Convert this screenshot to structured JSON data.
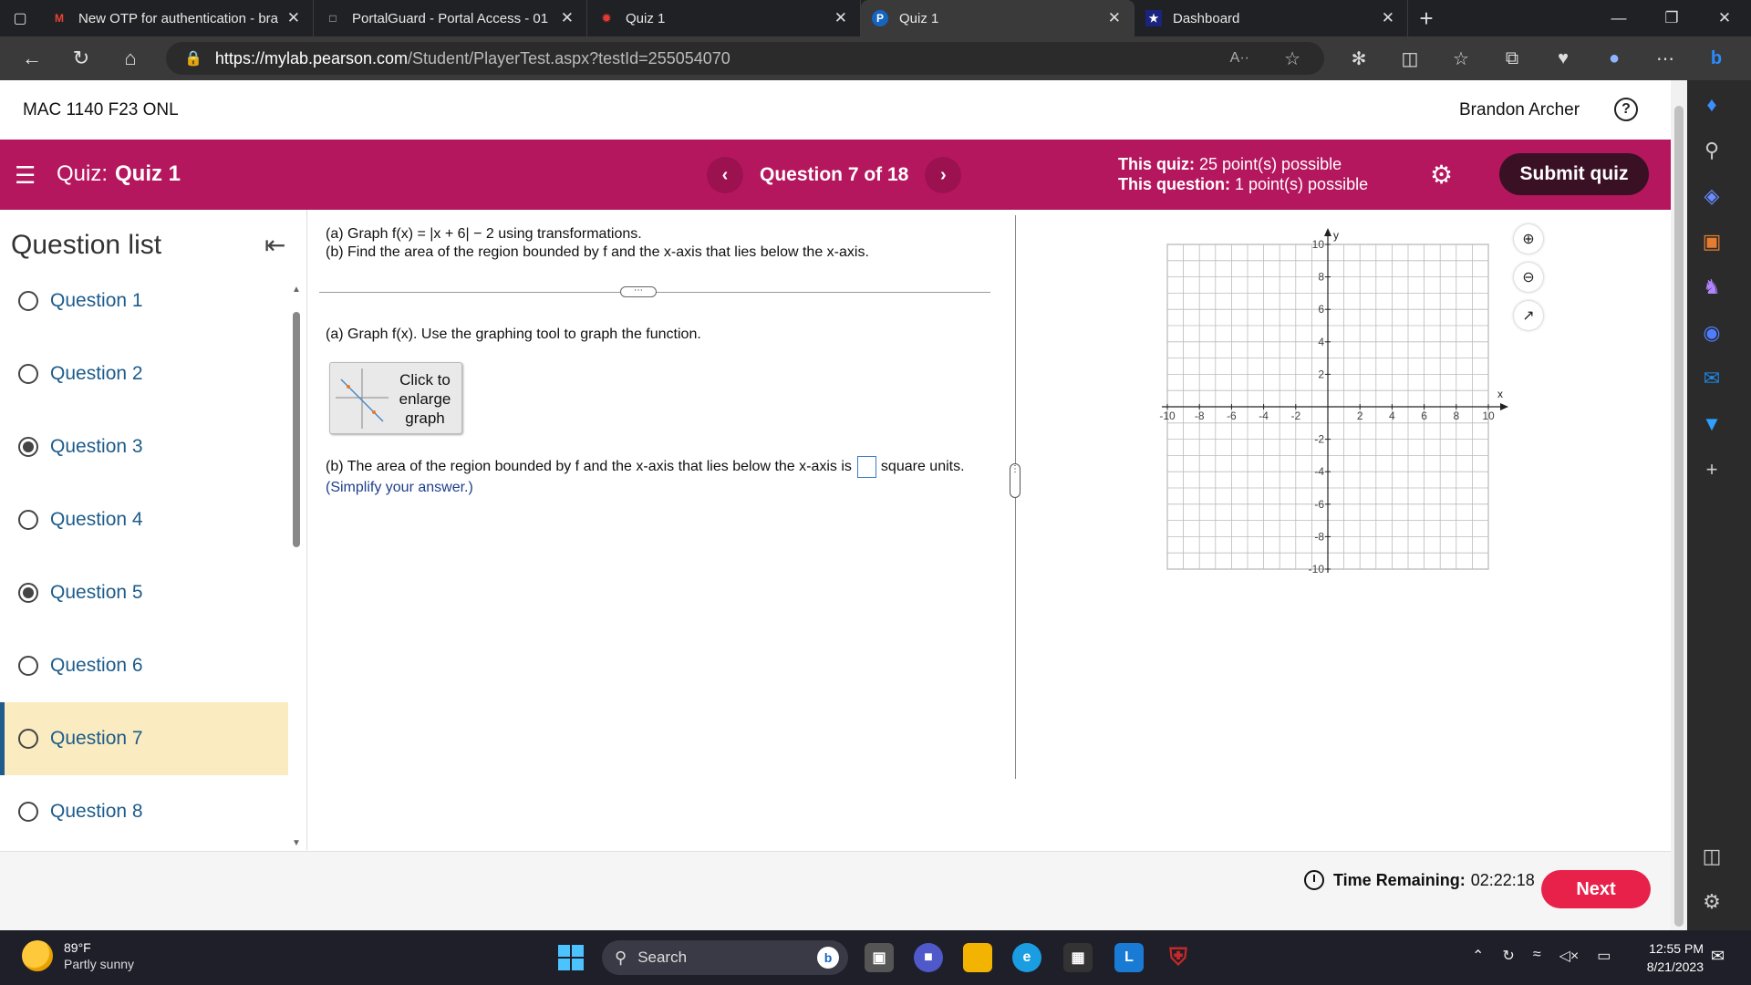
{
  "browser": {
    "tabs": [
      {
        "title": "New OTP for authentication - bra",
        "favicon": "gmail-icon",
        "active": false
      },
      {
        "title": "PortalGuard - Portal Access - 01",
        "favicon": "page-icon",
        "active": false
      },
      {
        "title": "Quiz 1",
        "favicon": "pinwheel-icon",
        "active": false
      },
      {
        "title": "Quiz 1",
        "favicon": "pearson-icon",
        "active": true
      },
      {
        "title": "Dashboard",
        "favicon": "star-icon",
        "active": false
      }
    ],
    "url_host": "https://mylab.pearson.com",
    "url_path": "/Student/PlayerTest.aspx?testId=255054070",
    "read_aloud": "A··"
  },
  "page": {
    "course": "MAC 1140 F23 ONL",
    "user": "Brandon Archer",
    "help": "?"
  },
  "quizbar": {
    "quiz_prefix": "Quiz:",
    "quiz_name": "Quiz 1",
    "question_label": "Question 7 of 18",
    "quiz_points_label": "This quiz:",
    "quiz_points_value": "25 point(s) possible",
    "question_points_label": "This question:",
    "question_points_value": "1 point(s) possible",
    "submit_label": "Submit quiz"
  },
  "question_list": {
    "title": "Question list",
    "items": [
      {
        "label": "Question 1",
        "answered": false,
        "current": false
      },
      {
        "label": "Question 2",
        "answered": false,
        "current": false
      },
      {
        "label": "Question 3",
        "answered": true,
        "current": false
      },
      {
        "label": "Question 4",
        "answered": false,
        "current": false
      },
      {
        "label": "Question 5",
        "answered": true,
        "current": false
      },
      {
        "label": "Question 6",
        "answered": false,
        "current": false
      },
      {
        "label": "Question 7",
        "answered": false,
        "current": true
      },
      {
        "label": "Question 8",
        "answered": false,
        "current": false
      }
    ]
  },
  "question": {
    "line_a": "(a) Graph f(x) = |x + 6| − 2 using transformations.",
    "line_b": "(b) Find the area of the region bounded by f and the x-axis that lies below the x-axis.",
    "part_a": "(a) Graph f(x). Use the graphing tool to graph the function.",
    "enlarge_label": "Click to enlarge graph",
    "part_b_before": "(b) The area of the region bounded by f and the x-axis that lies below the x-axis is",
    "part_b_answer": "",
    "part_b_after": "square units.",
    "simplify": "(Simplify your answer.)"
  },
  "graph": {
    "x_label": "x",
    "y_label": "y",
    "x_range": [
      -10,
      10
    ],
    "y_range": [
      -10,
      10
    ],
    "x_ticks": [
      "-10",
      "-8",
      "-6",
      "-4",
      "-2",
      "2",
      "4",
      "6",
      "8",
      "10"
    ],
    "y_ticks": [
      "10",
      "8",
      "6",
      "4",
      "2",
      "-2",
      "-4",
      "-6",
      "-8",
      "-10"
    ],
    "grid": true
  },
  "footer": {
    "time_label": "Time Remaining:",
    "time_value": "02:22:18",
    "next_label": "Next"
  },
  "taskbar": {
    "temperature": "89°F",
    "weather": "Partly sunny",
    "search": "Search",
    "time": "12:55 PM",
    "date": "8/21/2023"
  },
  "colors": {
    "quiz_bar": "#b5175e",
    "submit": "#3a1024",
    "next": "#e8214a",
    "current_question_bg": "#faebc0",
    "link": "#1d5c8c"
  }
}
